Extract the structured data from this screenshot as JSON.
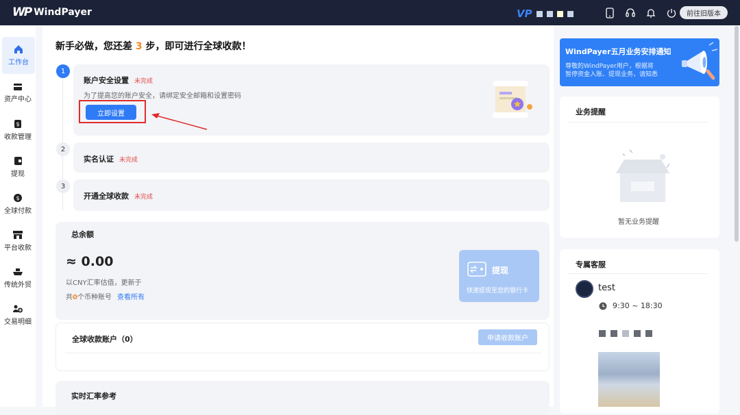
{
  "app": {
    "name": "WindPayer",
    "logo_mark": "WP",
    "old_version_label": "前往旧版本",
    "vip_badge": "VP"
  },
  "top_icons": [
    "mobile-icon",
    "headset-icon",
    "bell-icon",
    "power-icon"
  ],
  "sidebar": {
    "items": [
      {
        "label": "工作台",
        "icon": "home-icon",
        "active": true
      },
      {
        "label": "资产中心",
        "icon": "card-icon"
      },
      {
        "label": "收款管理",
        "icon": "receipt-icon"
      },
      {
        "label": "提现",
        "icon": "wallet-icon"
      },
      {
        "label": "全球付款",
        "icon": "coin-icon"
      },
      {
        "label": "平台收款",
        "icon": "store-icon"
      },
      {
        "label": "传统外贸",
        "icon": "ship-icon"
      },
      {
        "label": "交易明细",
        "icon": "people-icon"
      }
    ]
  },
  "main": {
    "heading_prefix": "新手必做，您还差 ",
    "heading_num": "3",
    "heading_suffix": " 步，即可进行全球收款！",
    "steps": [
      {
        "num": "1",
        "title": "账户安全设置",
        "status": "未完成",
        "desc": "为了提高您的账户安全，请绑定安全邮箱和设置密码",
        "button": "立即设置"
      },
      {
        "num": "2",
        "title": "实名认证",
        "status": "未完成"
      },
      {
        "num": "3",
        "title": "开通全球收款",
        "status": "未完成"
      }
    ],
    "balance": {
      "title": "总余额",
      "amount": "≈ 0.00",
      "note": "以CNY汇率估值，更新于",
      "count_prefix": "共",
      "count_num": "0",
      "count_suffix": "个币种账号",
      "view_all": "查看所有",
      "withdraw": {
        "title": "提现",
        "subtitle": "快速提现至您的银行卡"
      }
    },
    "accounts": {
      "title": "全球收款账户（0）",
      "apply_button": "申请收款账户"
    },
    "rates": {
      "title": "实时汇率参考"
    }
  },
  "right": {
    "notice": {
      "title": "WindPayer五月业务安排通知",
      "line1": "尊敬的WindPayer用户，根据将",
      "line2": "暂停资金入账、提现业务，请知悉"
    },
    "reminders": {
      "title": "业务提醒",
      "empty": "暂无业务提醒"
    },
    "service": {
      "title": "专属客服",
      "name": "test",
      "hours": "9:30 ~ 18:30"
    }
  },
  "colors": {
    "primary": "#2f7bf6",
    "topbar": "#1c2237",
    "warning": "#e34d4d",
    "accent": "#f08a24"
  }
}
